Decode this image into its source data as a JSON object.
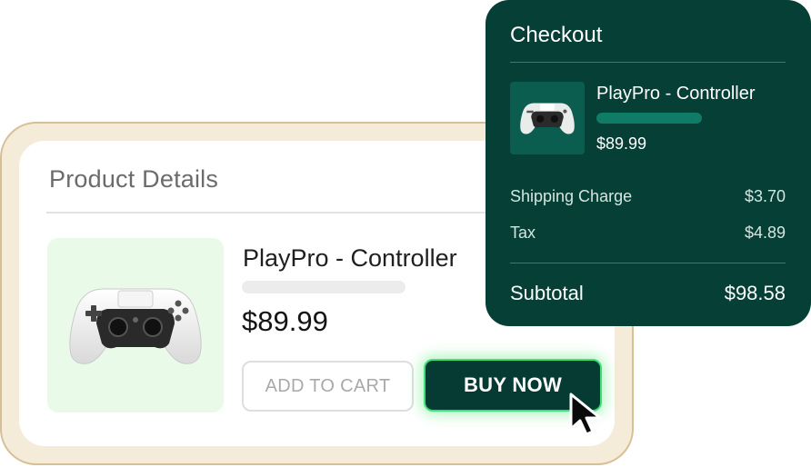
{
  "product": {
    "section_title": "Product Details",
    "name": "PlayPro - Controller",
    "price": "$89.99",
    "image_icon": "game-controller-icon",
    "add_to_cart_label": "ADD TO CART",
    "buy_now_label": "BUY NOW"
  },
  "checkout": {
    "title": "Checkout",
    "item": {
      "name": "PlayPro - Controller",
      "price": "$89.99",
      "image_icon": "game-controller-icon"
    },
    "rows": [
      {
        "label": "Shipping Charge",
        "value": "$3.70"
      },
      {
        "label": "Tax",
        "value": "$4.89"
      }
    ],
    "subtotal": {
      "label": "Subtotal",
      "value": "$98.58"
    }
  },
  "colors": {
    "checkout_bg": "#053f36",
    "buy_button_bg": "#053b32",
    "buy_button_glow": "#3fe07a",
    "product_image_bg": "#e9fbe8",
    "card_frame": "#f4ebd8"
  },
  "cursor_icon": "arrow-cursor-icon"
}
